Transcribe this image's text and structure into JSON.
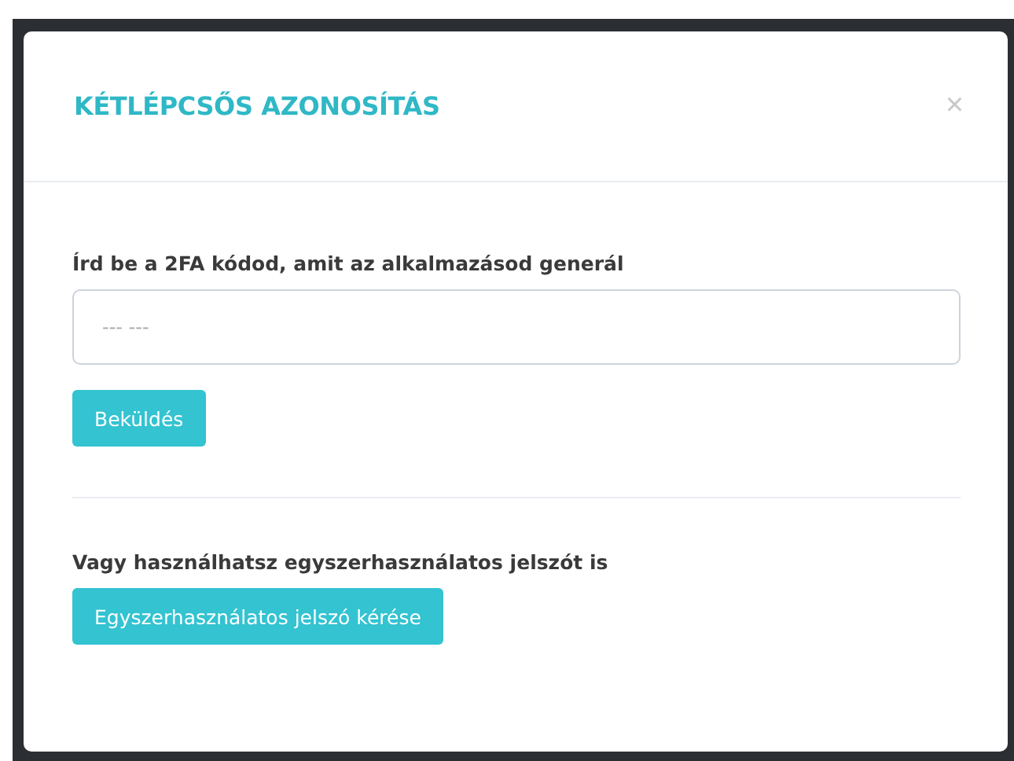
{
  "dialog": {
    "title": "KÉTLÉPCSŐS AZONOSÍTÁS",
    "close": "×"
  },
  "code_form": {
    "label": "Írd be a 2FA kódod, amit az alkalmazásod generál",
    "placeholder": "--- ---",
    "submit": "Beküldés"
  },
  "otp": {
    "text": "Vagy használhatsz egyszerhasználatos jelszót is",
    "button": "Egyszerhasználatos jelszó kérése"
  }
}
